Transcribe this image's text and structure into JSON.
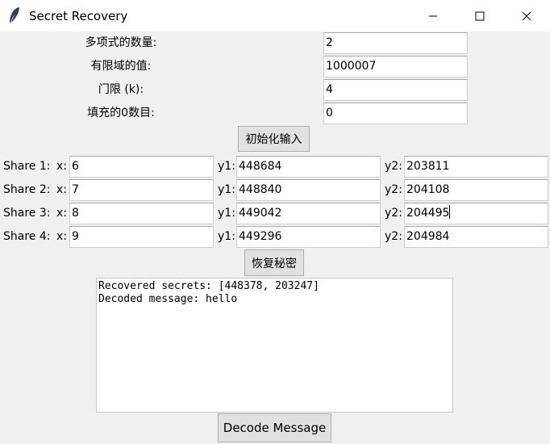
{
  "window": {
    "title": "Secret Recovery"
  },
  "params": {
    "poly_count_label": "多项式的数量:",
    "poly_count_value": "2",
    "field_label": "有限域的值:",
    "field_value": "1000007",
    "threshold_label": "门限 (k):",
    "threshold_value": "4",
    "padding_label": "填充的0数目:",
    "padding_value": "0"
  },
  "buttons": {
    "init": "初始化输入",
    "recover": "恢复秘密",
    "decode": "Decode Message"
  },
  "shares": [
    {
      "label": "Share 1:",
      "x_label": "x:",
      "x": "6",
      "y1_label": "y1:",
      "y1": "448684",
      "y2_label": "y2:",
      "y2": "203811"
    },
    {
      "label": "Share 2:",
      "x_label": "x:",
      "x": "7",
      "y1_label": "y1:",
      "y1": "448840",
      "y2_label": "y2:",
      "y2": "204108"
    },
    {
      "label": "Share 3:",
      "x_label": "x:",
      "x": "8",
      "y1_label": "y1:",
      "y1": "449042",
      "y2_label": "y2:",
      "y2": "204495"
    },
    {
      "label": "Share 4:",
      "x_label": "x:",
      "x": "9",
      "y1_label": "y1:",
      "y1": "449296",
      "y2_label": "y2:",
      "y2": "204984"
    }
  ],
  "output": {
    "line1": "Recovered secrets: [448378, 203247]",
    "line2": "Decoded message: hello"
  },
  "icons": {
    "app": "feather-icon",
    "minimize": "minimize-icon",
    "maximize": "maximize-icon",
    "close": "close-icon"
  }
}
